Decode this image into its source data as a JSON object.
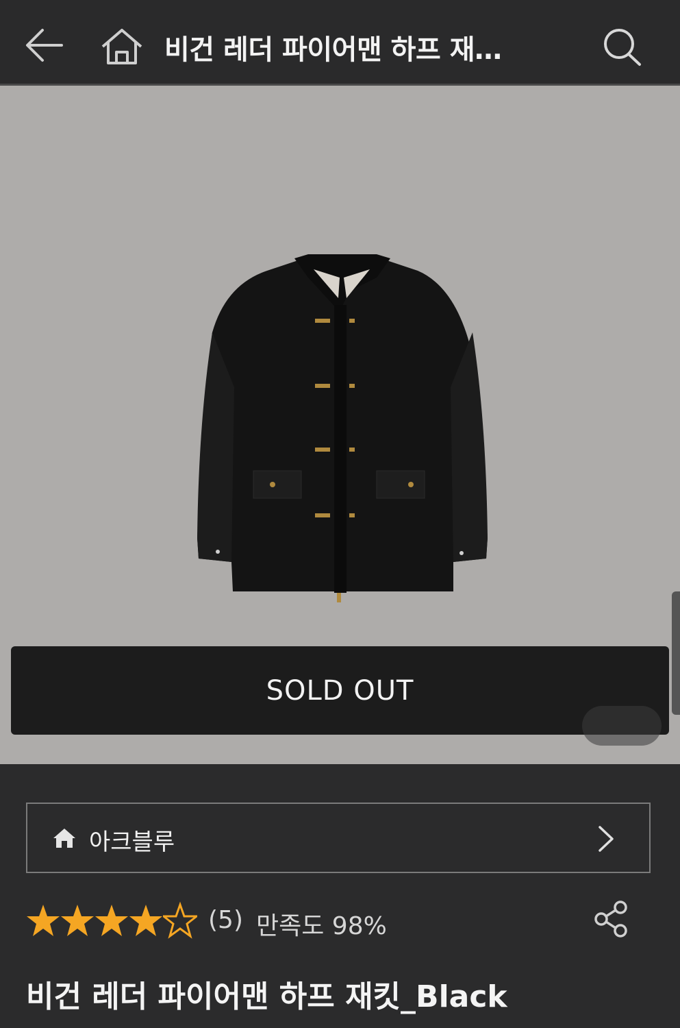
{
  "header": {
    "back_icon": "back-arrow-icon",
    "home_icon": "home-icon",
    "title": "비건 레더 파이어맨 하프 재…",
    "search_icon": "search-icon"
  },
  "hero": {
    "background_color": "#aeacaa",
    "image_subject": "black leather fireman jacket"
  },
  "sold_out_button": {
    "label": "SOLD OUT"
  },
  "brand": {
    "icon": "home-icon",
    "name": "아크블루",
    "chevron_icon": "chevron-right-icon"
  },
  "rating": {
    "stars_filled": 4,
    "stars_total": 5,
    "star_color": "#f5a623",
    "review_count": "(5)",
    "satisfaction": "만족도 98%"
  },
  "share_icon": "share-icon",
  "product": {
    "name": "비건 레더 파이어맨 하프 재킷_Black"
  }
}
